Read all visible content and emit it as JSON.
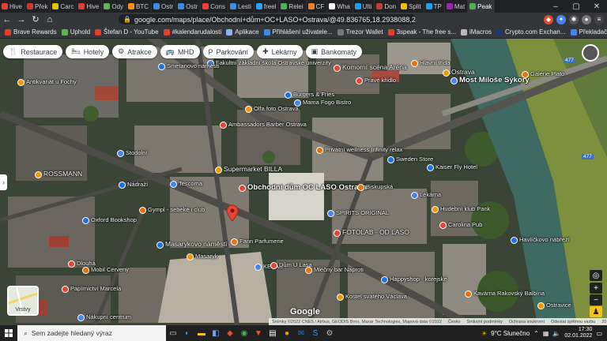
{
  "browser": {
    "tabs": [
      "Hive",
      "Přek",
      "Carc",
      "Hive",
      "Ody",
      "BTC",
      "Ostr",
      "Ostr",
      "Cons",
      "Lesti",
      "freel",
      "Relei",
      "CF",
      "Wha",
      "Ulti",
      "Don",
      "Split",
      "TP",
      "Mat",
      "Peak"
    ],
    "active_tab_index": 19,
    "address": "google.com/maps/place/Obchodní+dům+OC+LASO+Ostrava/@49.836765,18.2938088,279m/data=!3m1!1e3!4",
    "bookmarks": [
      "Brave Rewards",
      "Uphold",
      "Štefan D - YouTube",
      "#kalendarudalosti",
      "Aplikace",
      "Přihlášení uživatele...",
      "Trezor Wallet",
      "3speak - The free s...",
      "iMacros",
      "Crypto.com Exchan...",
      "Překladač Google",
      "JO9PQkt.png (642×..."
    ]
  },
  "chips": [
    {
      "icon": "restaurant-icon",
      "glyph": "🍴",
      "label": "Restaurace"
    },
    {
      "icon": "hotel-icon",
      "glyph": "🛏",
      "label": "Hotely"
    },
    {
      "icon": "attraction-icon",
      "glyph": "⚙",
      "label": "Atrakce"
    },
    {
      "icon": "transit-icon",
      "glyph": "🚌",
      "label": "MHD"
    },
    {
      "icon": "parking-icon",
      "glyph": "P",
      "label": "Parkování"
    },
    {
      "icon": "pharmacy-icon",
      "glyph": "✚",
      "label": "Lékárny"
    },
    {
      "icon": "atm-icon",
      "glyph": "▣",
      "label": "Bankomaty"
    }
  ],
  "map": {
    "place_name": "Obchodní dům OC LASO Ostrava",
    "labels": [
      {
        "t": "Antikvariát u Fochy",
        "k": "small"
      },
      {
        "t": "Fakultní základní škola Ostravské univerzity",
        "k": "small"
      },
      {
        "t": "Komorní scéna Aréna",
        "k": ""
      },
      {
        "t": "Hlavní třída",
        "k": "small"
      },
      {
        "t": "Smetanovo náměstí",
        "k": "small"
      },
      {
        "t": "Ostrava",
        "k": ""
      },
      {
        "t": "Most Miloše Sýkory",
        "k": "bold"
      },
      {
        "t": "Pravé křídlo",
        "k": "small"
      },
      {
        "t": "Galerie Plato",
        "k": "small"
      },
      {
        "t": "Burgers & Fries",
        "k": "small"
      },
      {
        "t": "Olfa foto Ostrava",
        "k": "small"
      },
      {
        "t": "Mama Fogo Bistro",
        "k": "small"
      },
      {
        "t": "Ambassadors Barber Ostrava",
        "k": "small"
      },
      {
        "t": "Privátní wellness Infinity relax",
        "k": "small"
      },
      {
        "t": "Sweden Store",
        "k": "small"
      },
      {
        "t": "Supermarket BILLA",
        "k": ""
      },
      {
        "t": "Tescoma",
        "k": "small"
      },
      {
        "t": "Obchodní dům OC LASO Ostrava",
        "k": "bold"
      },
      {
        "t": "Gympl - sebeké i club",
        "k": "small"
      },
      {
        "t": "Oxford Bookshop",
        "k": "small"
      },
      {
        "t": "ROSSMANN",
        "k": ""
      },
      {
        "t": "SPIRITS ORIGINAL",
        "k": "small"
      },
      {
        "t": "FOTOLAB - OD LASO",
        "k": ""
      },
      {
        "t": "Fann Parfumerie",
        "k": "small"
      },
      {
        "t": "Masarykovo náměstí",
        "k": ""
      },
      {
        "t": "Masaryk",
        "k": "small"
      },
      {
        "t": "KEBAB",
        "k": "small"
      },
      {
        "t": "Dům U Lasa",
        "k": "small"
      },
      {
        "t": "Mléčný bar Naproti",
        "k": "small"
      },
      {
        "t": "Happyshop - korejské",
        "k": "small"
      },
      {
        "t": "Kostel svatého Václava",
        "k": "small"
      },
      {
        "t": "Nákupní centrum",
        "k": "small"
      },
      {
        "t": "Papírnictví Marcela",
        "k": "small"
      },
      {
        "t": "Biskupská",
        "k": "small"
      },
      {
        "t": "Kaiser Fly Hotel",
        "k": "small"
      },
      {
        "t": "Hudební klub Pank",
        "k": "small"
      },
      {
        "t": "Lékárna",
        "k": "small"
      },
      {
        "t": "Carolina Pub",
        "k": "small"
      },
      {
        "t": "Kavárna Rakovský Balbína",
        "k": "small"
      },
      {
        "t": "Havlíčkovo nábřeží",
        "k": "small"
      },
      {
        "t": "Ostravice",
        "k": "small"
      },
      {
        "t": "Stodolní",
        "k": "small"
      },
      {
        "t": "Dlouhá",
        "k": "small"
      },
      {
        "t": "Mobil Cerveny",
        "k": "small"
      },
      {
        "t": "Nádraží",
        "k": "small"
      }
    ],
    "road_badges": [
      "477",
      "477"
    ],
    "layers_label": "Vrstvy",
    "google_logo": "Google",
    "attribution": [
      "Snímky ©2022 CNES / Airbus, GEODIS Brno, Maxar Technologies, Mapová data ©2022",
      "Česko",
      "Smluvní podmínky",
      "Ochrana soukromí",
      "Odeslat zpětnou vazbu",
      "20 m"
    ]
  },
  "taskbar": {
    "search_placeholder": "Sem zadejte hledaný výraz",
    "weather": "9°C  Slunečno",
    "time": "17:30",
    "date": "02.01.2022"
  },
  "colors": {
    "pin": "#ea4335",
    "chip_bg": "#ffffff",
    "taskbar": "#202020"
  }
}
